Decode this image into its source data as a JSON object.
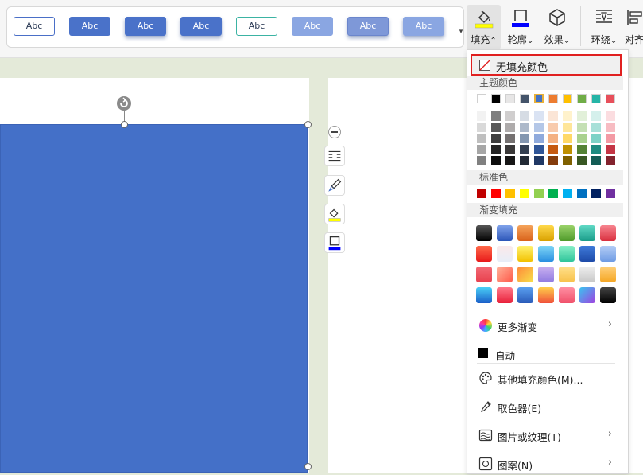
{
  "toolbar": {
    "style_presets": [
      {
        "label": "Abc",
        "bg": "#ffffff",
        "fg": "#2b3a55",
        "border": "#4a6fc7"
      },
      {
        "label": "Abc",
        "bg": "#4a72c9",
        "fg": "#ffffff",
        "border": "#4a72c9"
      },
      {
        "label": "Abc",
        "bg": "#4a72c9",
        "fg": "#ffffff",
        "border": "#4a72c9"
      },
      {
        "label": "Abc",
        "bg": "#4a72c9",
        "fg": "#ffffff",
        "border": "#4a72c9"
      },
      {
        "label": "Abc",
        "bg": "#ffffff",
        "fg": "#2b3a55",
        "border": "#3bb3a3"
      },
      {
        "label": "Abc",
        "bg": "#8aa6e2",
        "fg": "#ffffff",
        "border": "#8aa6e2"
      },
      {
        "label": "Abc",
        "bg": "#7e98d8",
        "fg": "#ffffff",
        "border": "#6b86cc"
      },
      {
        "label": "Abc",
        "bg": "#8aa6e2",
        "fg": "#ffffff",
        "border": "#8aa6e2"
      }
    ],
    "fill_label": "填充",
    "outline_label": "轮廓",
    "effect_label": "效果",
    "wrap_label": "环绕",
    "align_label": "对齐",
    "dropdown_caret_up": "⌃",
    "dropdown_caret_down": "⌄"
  },
  "menu": {
    "no_fill": "无填充颜色",
    "theme_colors_title": "主题颜色",
    "theme_top": [
      "#ffffff",
      "#000000",
      "#e7e6e6",
      "#44546a",
      "#4472c4",
      "#ed7d31",
      "#ffc000",
      "#70ad47",
      "#26b5a7",
      "#e8505b"
    ],
    "theme_shades": [
      [
        "#f2f2f2",
        "#7f7f7f",
        "#d0cece",
        "#d6dce4",
        "#dae3f3",
        "#fbe5d6",
        "#fff2cc",
        "#e2f0d9",
        "#d5f0ec",
        "#fbdde0"
      ],
      [
        "#d9d9d9",
        "#595959",
        "#aeabab",
        "#adb9ca",
        "#b4c7e7",
        "#f8cbad",
        "#ffe699",
        "#c5e0b4",
        "#a8e0d8",
        "#f7bcc2"
      ],
      [
        "#bfbfbf",
        "#3f3f3f",
        "#757171",
        "#8497b0",
        "#8faadc",
        "#f4b183",
        "#ffd966",
        "#a9d18e",
        "#7dd2c6",
        "#f39aa4"
      ],
      [
        "#a6a6a6",
        "#262626",
        "#3a3838",
        "#333f50",
        "#2f5597",
        "#c55a11",
        "#bf9000",
        "#548235",
        "#1d8b80",
        "#c43545"
      ],
      [
        "#808080",
        "#0d0d0d",
        "#171616",
        "#222a35",
        "#203864",
        "#843c0c",
        "#7f6000",
        "#385723",
        "#135c55",
        "#83232e"
      ]
    ],
    "standard_colors_title": "标准色",
    "standard_colors": [
      "#c00000",
      "#ff0000",
      "#ffc000",
      "#ffff00",
      "#92d050",
      "#00b050",
      "#00b0f0",
      "#0070c0",
      "#002060",
      "#7030a0"
    ],
    "gradient_title": "渐变填充",
    "gradients": [
      [
        "linear-gradient(#555,#000)",
        "linear-gradient(#7fa2ea,#2c56b8)",
        "linear-gradient(#f5a35a,#d9621a)",
        "linear-gradient(#ffd84a,#d9a100)",
        "linear-gradient(#9ad26a,#4f9a2a)",
        "linear-gradient(#5fd8c4,#1a9c8a)",
        "linear-gradient(#f7848f,#d9303f)"
      ],
      [
        "linear-gradient(#ff6a4a,#e81a1a)",
        "linear-gradient(#fbe9ea,#e8eef8)",
        "linear-gradient(#fff270,#f2c100)",
        "linear-gradient(#7fd6f7,#2a8fe0)",
        "linear-gradient(#8af0c8,#2ec49a)",
        "linear-gradient(#3f7ad9,#1d4aa8)",
        "linear-gradient(#b4cdf6,#6e9be4)"
      ],
      [
        "linear-gradient(#f36a74,#e8404e)",
        "linear-gradient(135deg,#ffb39a,#ff5a4a)",
        "linear-gradient(135deg,#ff8a3a,#f7e04a)",
        "linear-gradient(#c9b0f0,#8f7ae0)",
        "linear-gradient(#ffe08a,#f7c14a)",
        "linear-gradient(#eeeeee,#c7c7c7)",
        "linear-gradient(#ffd07a,#f5a623)"
      ],
      [
        "linear-gradient(#4ad0f7,#1a5ec8)",
        "linear-gradient(#ff7a8a,#e8203a)",
        "linear-gradient(#5aa0f0,#2a5ab8)",
        "linear-gradient(#ffcf4a,#f0503a)",
        "linear-gradient(#ff8fa3,#f0506a)",
        "linear-gradient(135deg,#3ac4f0,#a040e0)",
        "linear-gradient(#444,#000)"
      ]
    ],
    "more_gradients": "更多渐变",
    "auto": "自动",
    "other_fill_color": "其他填充颜色(M)...",
    "eyedropper": "取色器(E)",
    "picture_texture": "图片或纹理(T)",
    "pattern": "图案(N)",
    "arrow": "›"
  }
}
